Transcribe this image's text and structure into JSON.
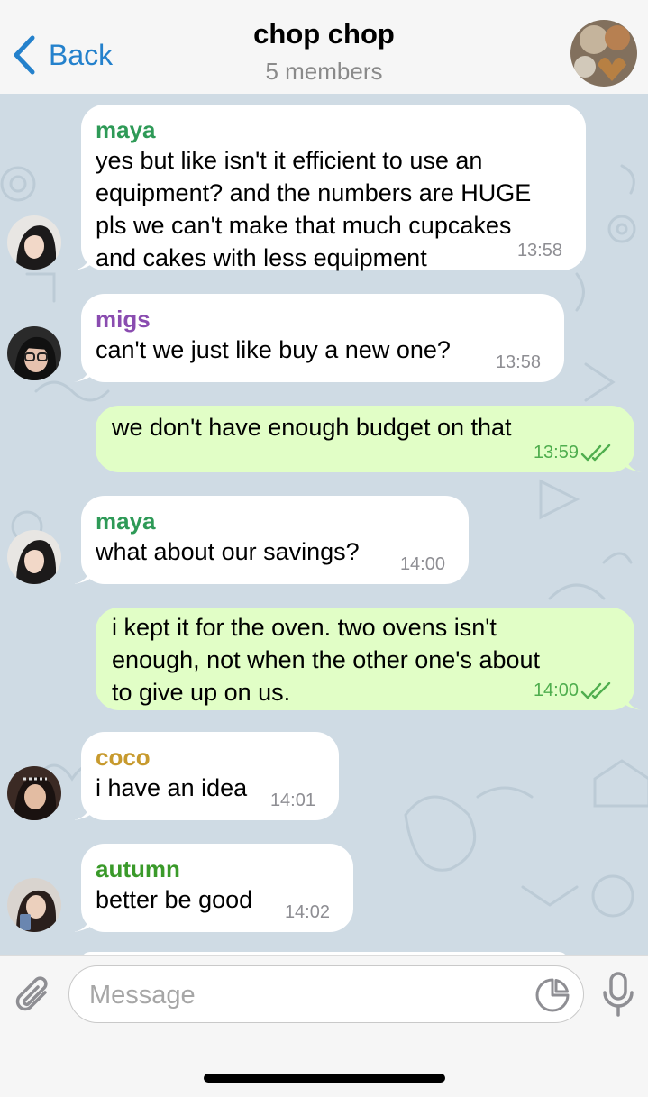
{
  "header": {
    "back_label": "Back",
    "title": "chop chop",
    "subtitle": "5 members"
  },
  "messages": [
    {
      "sender": "maya",
      "sender_color": "#2e9a57",
      "lines": [
        "yes but like isn't it efficient to use an",
        "equipment? and the numbers are HUGE",
        "pls we can't make that much cupcakes",
        "and cakes with less equipment"
      ],
      "time": "13:58"
    },
    {
      "sender": "migs",
      "sender_color": "#8a4cb0",
      "lines": [
        "can't we just like buy a new one?"
      ],
      "time": "13:58"
    },
    {
      "lines": [
        "we don't have enough budget on that"
      ],
      "time": "13:59",
      "outgoing": true
    },
    {
      "sender": "maya",
      "sender_color": "#2e9a57",
      "lines": [
        "what about our savings?"
      ],
      "time": "14:00"
    },
    {
      "lines": [
        "i kept it for the oven. two ovens isn't",
        "enough, not when the other one's about",
        "to give up on us."
      ],
      "time": "14:00",
      "outgoing": true
    },
    {
      "sender": "coco",
      "sender_color": "#c79a2e",
      "lines": [
        "i have an idea"
      ],
      "time": "14:01"
    },
    {
      "sender": "autumn",
      "sender_color": "#3a9a2a",
      "lines": [
        "better be good"
      ],
      "time": "14:02"
    }
  ],
  "input": {
    "placeholder": "Message"
  },
  "colors": {
    "accent": "#2481cc",
    "outgoing_bubble": "#e1fec6",
    "incoming_bubble": "#ffffff",
    "chat_background": "#cfdbe4",
    "read_checks": "#4fae4e"
  },
  "icons": [
    "chevron-left-icon",
    "paperclip-icon",
    "sticker-icon",
    "microphone-icon",
    "double-check-icon"
  ]
}
